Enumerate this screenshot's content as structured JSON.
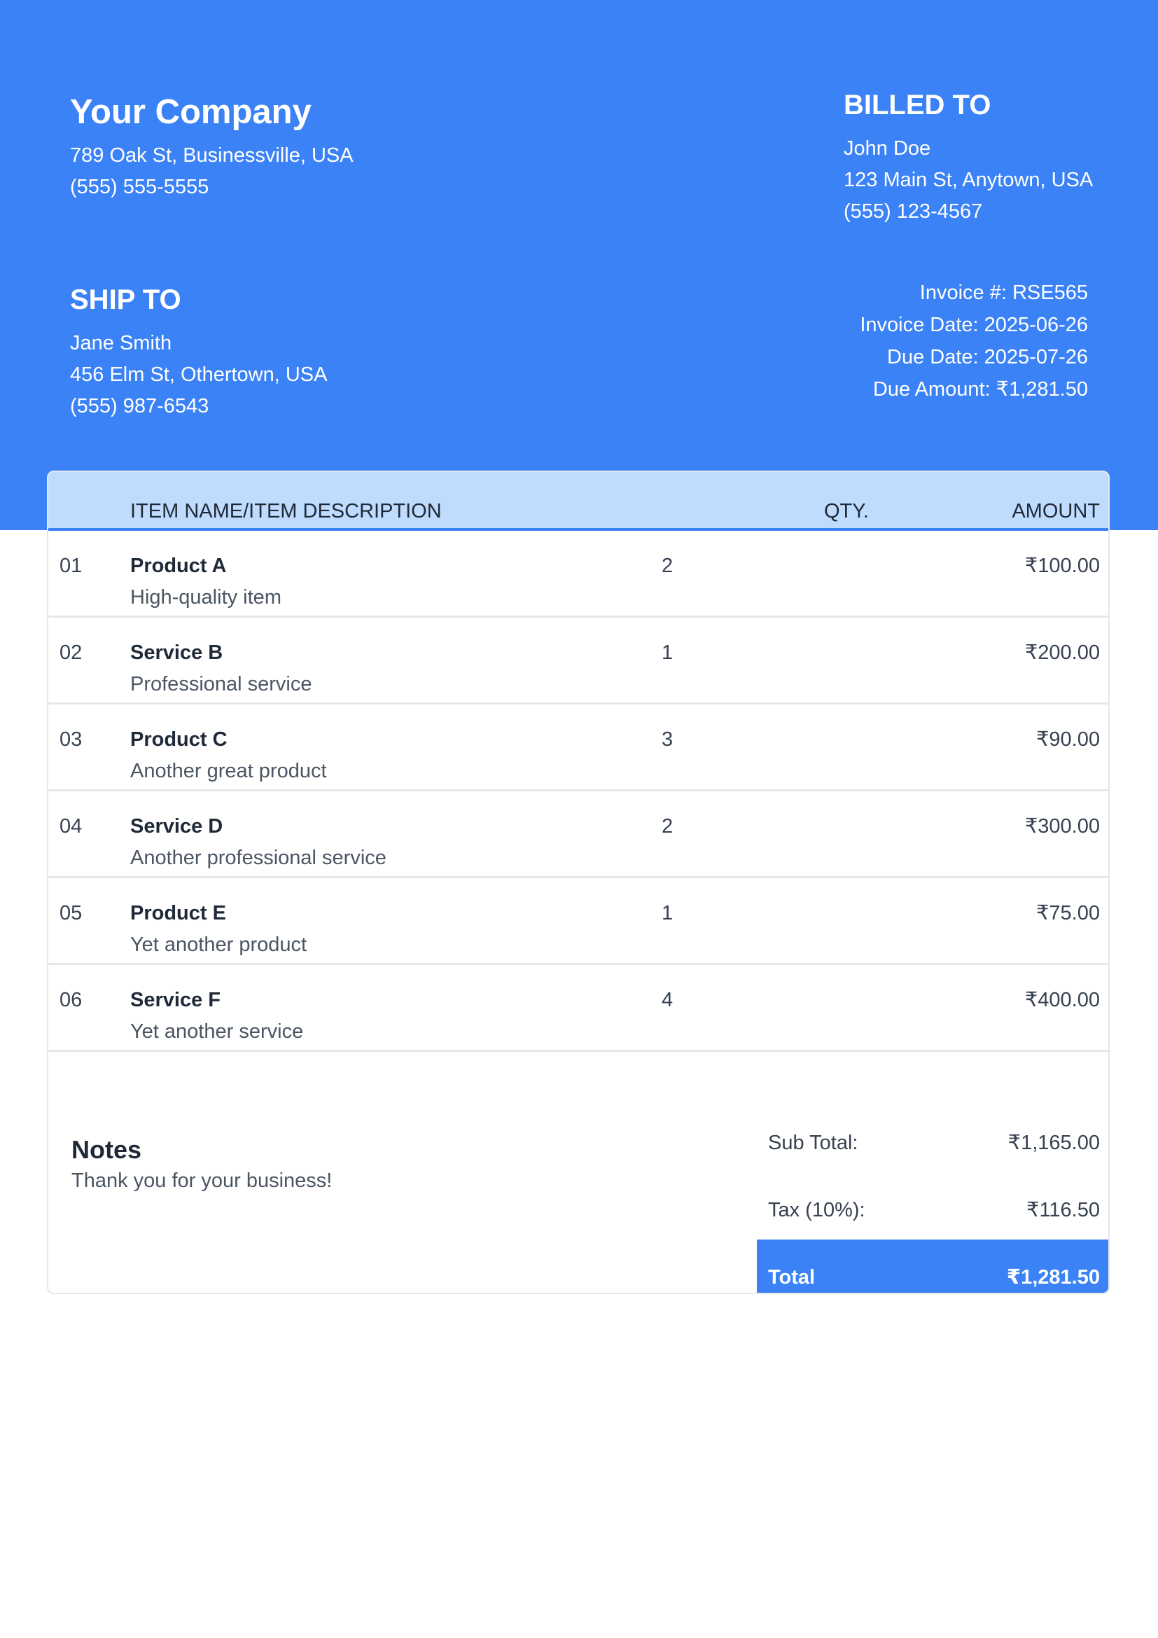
{
  "company": {
    "name": "Your Company",
    "address": "789 Oak St, Businessville, USA",
    "phone": "(555) 555-5555"
  },
  "billed_to": {
    "heading": "BILLED TO",
    "name": "John Doe",
    "address": "123 Main St, Anytown, USA",
    "phone": "(555) 123-4567"
  },
  "ship_to": {
    "heading": "SHIP TO",
    "name": "Jane Smith",
    "address": "456 Elm St, Othertown, USA",
    "phone": "(555) 987-6543"
  },
  "invoice_meta": {
    "number": "Invoice #: RSE565",
    "date": "Invoice Date: 2025-06-26",
    "due_date": "Due Date: 2025-07-26",
    "due_amount": "Due Amount: ₹1,281.50"
  },
  "table": {
    "headers": {
      "description": "ITEM NAME/ITEM DESCRIPTION",
      "qty": "QTY.",
      "amount": "AMOUNT"
    },
    "rows": [
      {
        "no": "01",
        "name": "Product A",
        "desc": "High-quality item",
        "qty": "2",
        "amount": "₹100.00"
      },
      {
        "no": "02",
        "name": "Service B",
        "desc": "Professional service",
        "qty": "1",
        "amount": "₹200.00"
      },
      {
        "no": "03",
        "name": "Product C",
        "desc": "Another great product",
        "qty": "3",
        "amount": "₹90.00"
      },
      {
        "no": "04",
        "name": "Service D",
        "desc": "Another professional service",
        "qty": "2",
        "amount": "₹300.00"
      },
      {
        "no": "05",
        "name": "Product E",
        "desc": "Yet another product",
        "qty": "1",
        "amount": "₹75.00"
      },
      {
        "no": "06",
        "name": "Service F",
        "desc": "Yet another service",
        "qty": "4",
        "amount": "₹400.00"
      }
    ]
  },
  "notes": {
    "title": "Notes",
    "text": "Thank you for your business!"
  },
  "totals": {
    "subtotal_label": "Sub Total:",
    "subtotal_value": "₹1,165.00",
    "tax_label": "Tax (10%):",
    "tax_value": "₹116.50",
    "total_label": "Total",
    "total_value": "₹1,281.50"
  },
  "colors": {
    "accent": "#3b82f6",
    "table_header": "#bfdbfe"
  }
}
